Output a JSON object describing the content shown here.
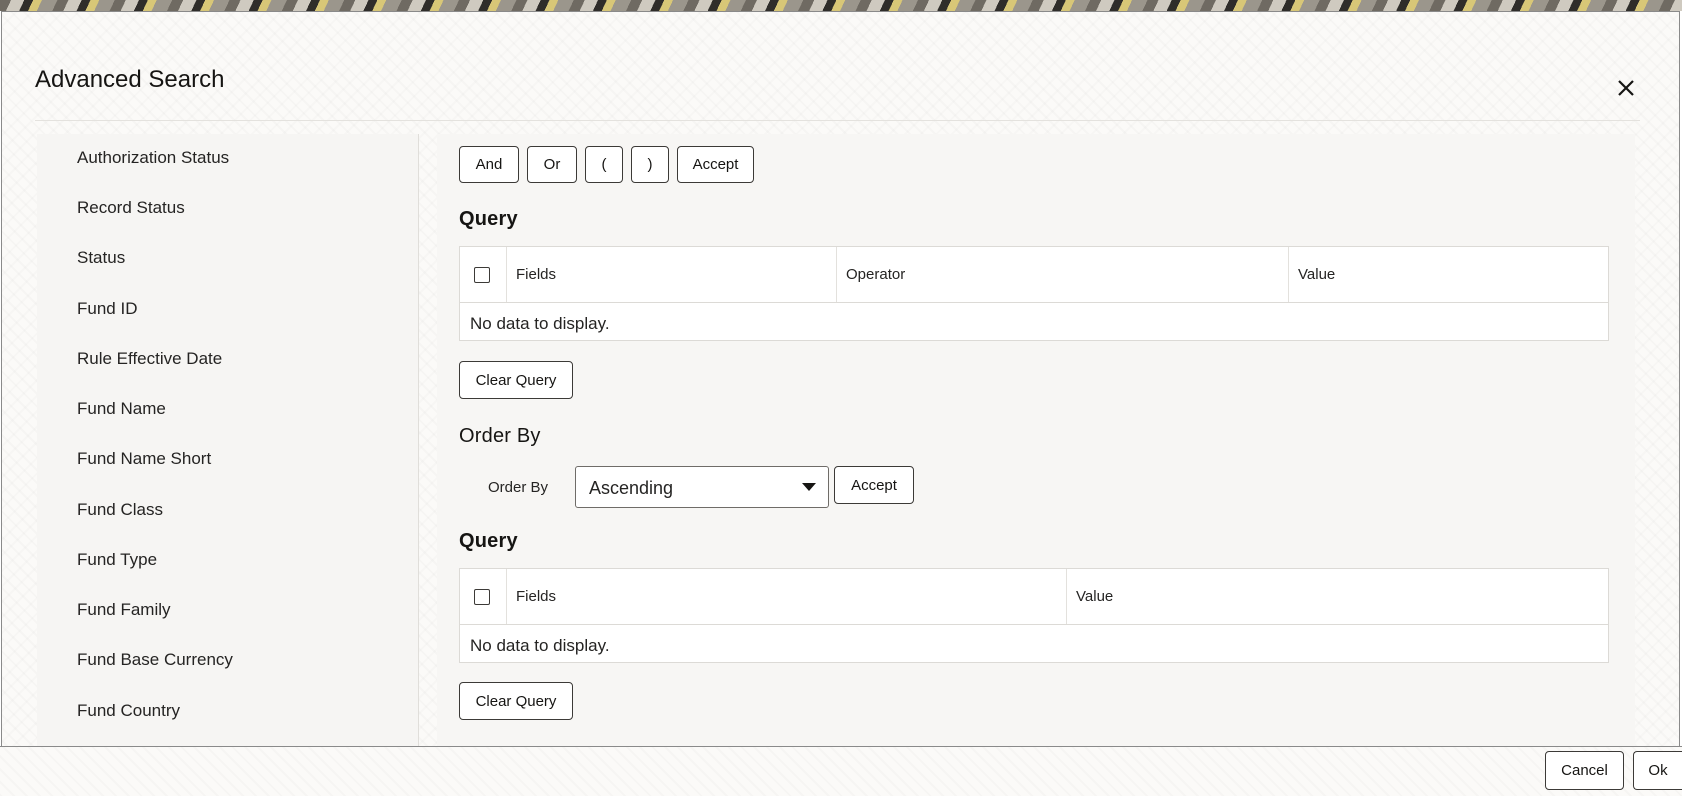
{
  "dialog": {
    "title": "Advanced Search",
    "close_icon": "close-icon"
  },
  "fields": [
    "Authorization Status",
    "Record Status",
    "Status",
    "Fund ID",
    "Rule Effective Date",
    "Fund Name",
    "Fund Name Short",
    "Fund Class",
    "Fund Type",
    "Fund Family",
    "Fund Base Currency",
    "Fund Country"
  ],
  "operators": {
    "and": "And",
    "or": "Or",
    "open_paren": "(",
    "close_paren": ")",
    "accept": "Accept"
  },
  "query": {
    "title": "Query",
    "columns": [
      "Fields",
      "Operator",
      "Value"
    ],
    "empty_text": "No data to display.",
    "clear_label": "Clear Query"
  },
  "order_by": {
    "title": "Order By",
    "label": "Order By",
    "selected": "Ascending",
    "accept": "Accept"
  },
  "order_query": {
    "title": "Query",
    "columns": [
      "Fields",
      "Value"
    ],
    "empty_text": "No data to display.",
    "clear_label": "Clear Query"
  },
  "footer": {
    "cancel": "Cancel",
    "ok": "Ok"
  }
}
